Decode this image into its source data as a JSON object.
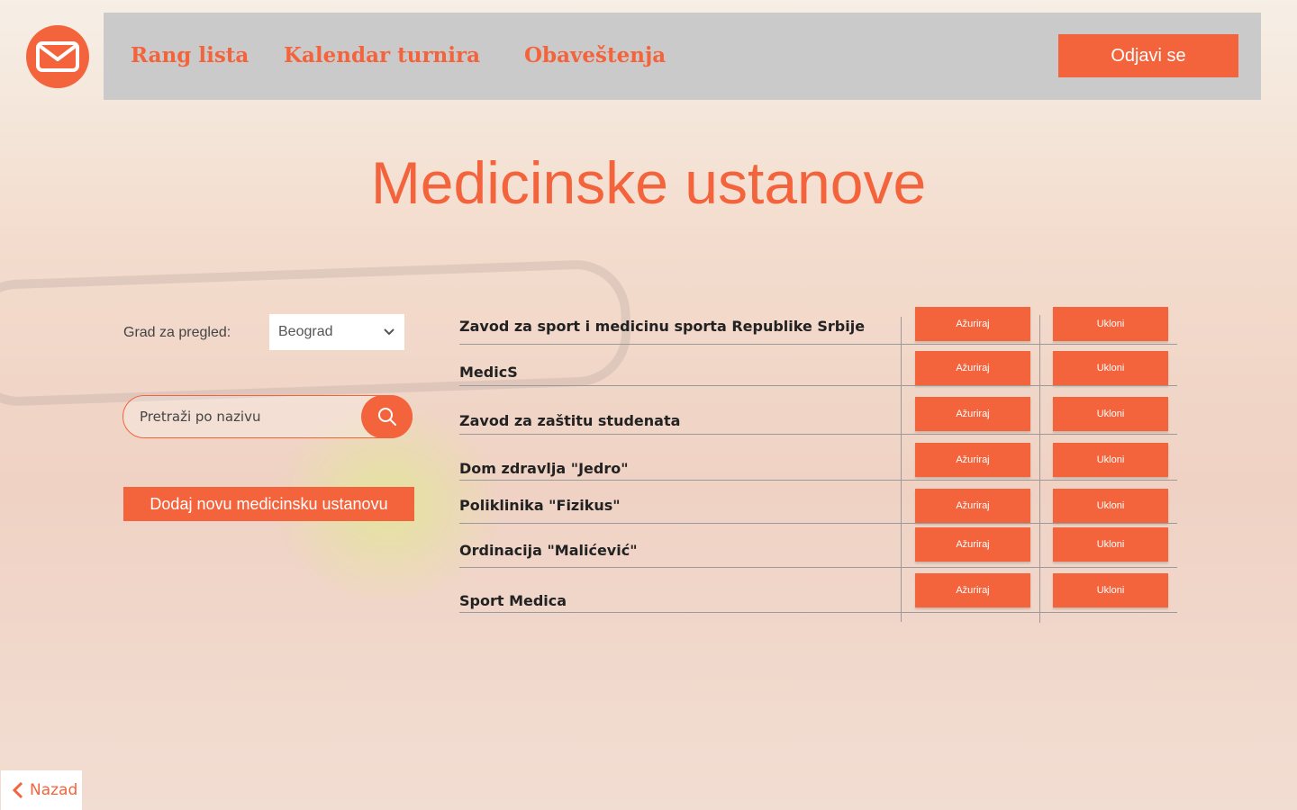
{
  "nav": {
    "links": [
      "Rang lista",
      "Kalendar turnira",
      "Obaveštenja"
    ],
    "logout_label": "Odjavi se"
  },
  "page": {
    "title": "Medicinske ustanove"
  },
  "filters": {
    "city_label": "Grad za pregled:",
    "city_value": "Beograd",
    "search_placeholder": "Pretraži po nazivu",
    "add_label": "Dodaj novu medicinsku ustanovu"
  },
  "institutions": [
    "Zavod za sport i medicinu sporta Republike Srbije",
    "MedicS",
    "Zavod za zaštitu studenata",
    "Dom zdravlja \"Jedro\"",
    "Poliklinika \"Fizikus\"",
    "Ordinacija \"Malićević\"",
    "Sport Medica"
  ],
  "row_actions": {
    "update_label": "Ažuriraj",
    "remove_label": "Ukloni"
  },
  "back_label": "Nazad",
  "colors": {
    "accent": "#f4643c",
    "navbar": "#c8c8c8"
  }
}
